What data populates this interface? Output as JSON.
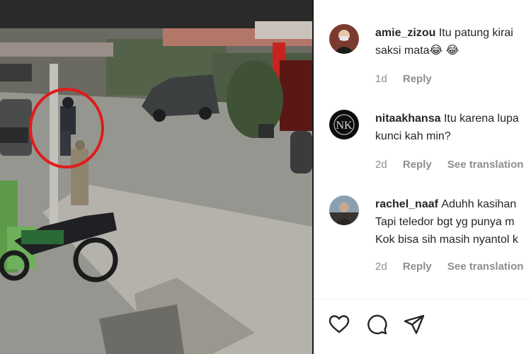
{
  "comments": [
    {
      "username": "amie_zizou",
      "lines": [
        "Itu patung kirai",
        "saksi mata😂 😂"
      ],
      "time": "1d",
      "reply": "Reply",
      "translate": ""
    },
    {
      "username": "nitaakhansa",
      "lines": [
        "Itu karena lupa",
        "kunci kah min?"
      ],
      "time": "2d",
      "reply": "Reply",
      "translate": "See translation"
    },
    {
      "username": "rachel_naaf",
      "lines": [
        "Aduhh kasihan",
        "Tapi teledor bgt yg punya m",
        "Kok bisa sih masih nyantol k"
      ],
      "time": "2d",
      "reply": "Reply",
      "translate": "See translation"
    }
  ],
  "actions": {
    "icons": [
      "heart-icon",
      "comment-icon",
      "share-icon"
    ]
  },
  "video": {
    "highlight_color": "#e01b1b"
  }
}
